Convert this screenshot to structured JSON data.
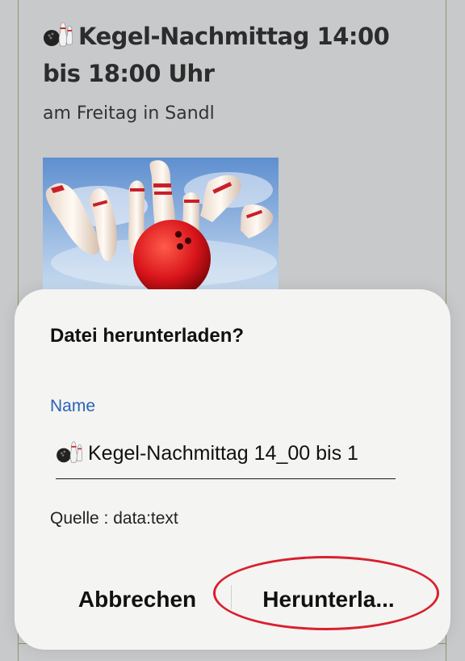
{
  "article": {
    "title": "Kegel-Nachmittag 14:00 bis 18:00 Uhr",
    "subtitle": "am Freitag in Sandl"
  },
  "dialog": {
    "title": "Datei herunterladen?",
    "name_label": "Name",
    "filename_value": "Kegel-Nachmittag 14_00 bis 1",
    "source": "Quelle : data:text",
    "cancel_label": "Abbrechen",
    "download_label": "Herunterla..."
  },
  "colors": {
    "accent_blue": "#2a63b8",
    "annotation_red": "#d8202f",
    "dialog_bg": "#f4f4f2",
    "page_bg": "#c8c9cb"
  },
  "icons": {
    "title_icon": "bowling-icon",
    "filename_icon": "bowling-icon"
  }
}
